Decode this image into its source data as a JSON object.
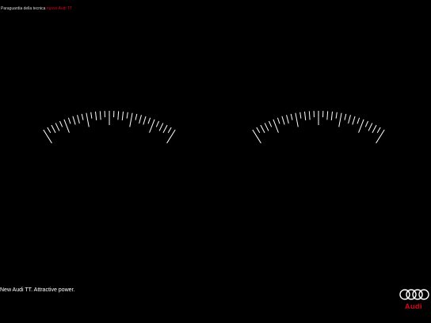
{
  "header": {
    "prefix": "Paraguardia della tecnica",
    "accent": "nuovo Audi TT",
    "accent_color": "#e2001a"
  },
  "gauges": [
    {
      "name": "left-gauge-eye",
      "ticks": 31
    },
    {
      "name": "right-gauge-eye",
      "ticks": 31
    }
  ],
  "footer": {
    "tagline": "New Audi TT. Attractive power."
  },
  "logo": {
    "brand": "Audi",
    "rings": 4,
    "brand_color": "#e2001a"
  }
}
